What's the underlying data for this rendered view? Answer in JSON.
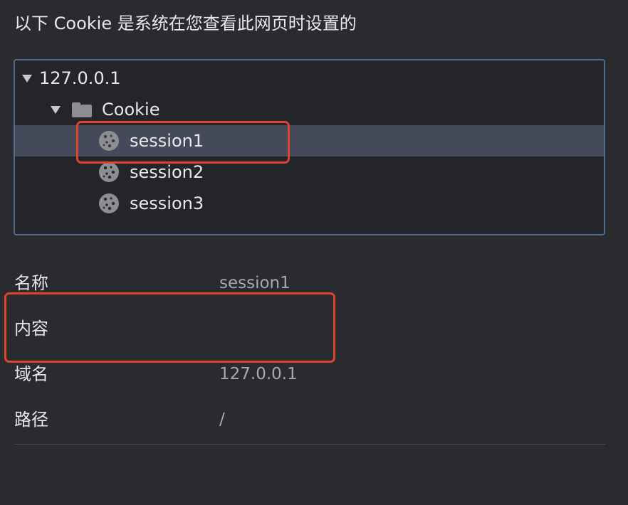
{
  "header": {
    "title": "以下 Cookie 是系统在您查看此网页时设置的"
  },
  "tree": {
    "host": "127.0.0.1",
    "folder": "Cookie",
    "cookies": [
      "session1",
      "session2",
      "session3"
    ],
    "selected_index": 0
  },
  "details": {
    "name_label": "名称",
    "name_value": "session1",
    "content_label": "内容",
    "content_value": "",
    "domain_label": "域名",
    "domain_value": "127.0.0.1",
    "path_label": "路径",
    "path_value": "/"
  },
  "colors": {
    "background": "#2a2b2f",
    "selection": "#454a5b",
    "focus_border": "#4e6a8f",
    "annotation": "#e2432c"
  }
}
